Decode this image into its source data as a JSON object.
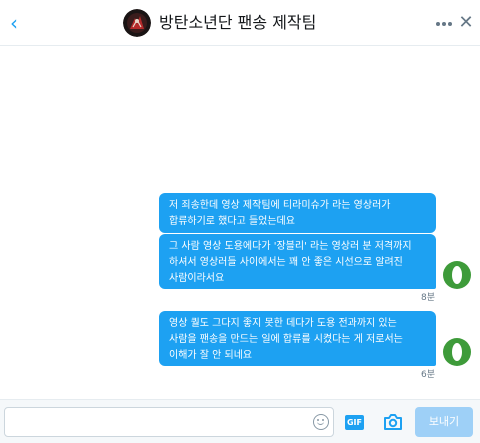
{
  "header": {
    "back_icon": "chevron-left-icon",
    "title": "방탄소년단 팬송 제작팀",
    "more_icon": "more-dots-icon",
    "close_icon": "close-icon"
  },
  "messages": [
    {
      "text": "저 죄송한데 영상 제작팀에 티라미슈가 라는 영상러가 합류하기로 했다고 들었는데요"
    },
    {
      "text": "그 사람 영상 도용에다가 '장블리' 라는 영상러 분 저격까지 하셔서 영상러들 사이에서는 꽤 안 좋은 시선으로 알려진 사람이라서요"
    },
    {
      "text": "영상 퀄도 그다지 좋지 못한 데다가 도용 전과까지 있는 사람을 팬송을 만드는 일에 합류를 시켰다는 게 저로서는 이해가 잘 안 되네요"
    }
  ],
  "timestamps": [
    "8분",
    "6분"
  ],
  "composer": {
    "input_value": "",
    "input_placeholder": "",
    "emoji_icon": "emoji-icon",
    "gif_label": "GIF",
    "camera_icon": "camera-icon",
    "send_label": "보내기"
  },
  "colors": {
    "accent": "#1da1f2",
    "send_disabled": "#9ed0f7",
    "sender_avatar": "#3e9b3a",
    "icon_gray": "#657786"
  }
}
